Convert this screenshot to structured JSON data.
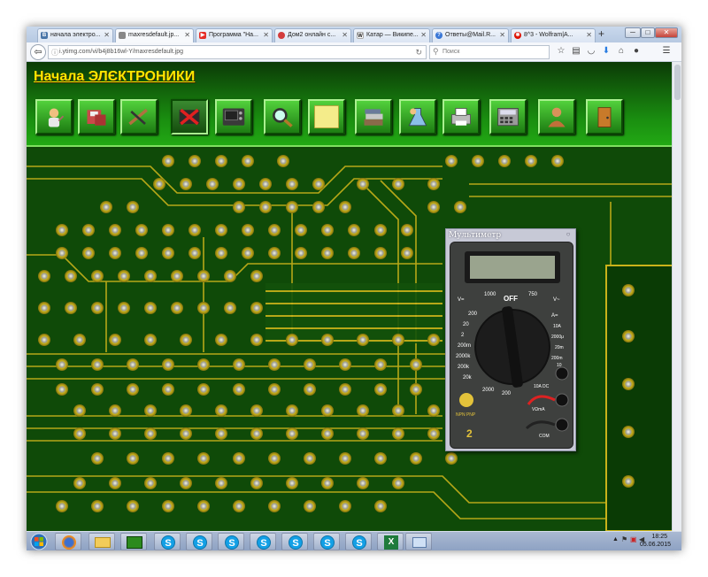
{
  "browser": {
    "tabs": [
      {
        "label": "начала электро...",
        "icon": "vk-icon",
        "color": "#4a76a8"
      },
      {
        "label": "maxresdefault.jp...",
        "icon": "image-icon",
        "color": "#888888",
        "active": true
      },
      {
        "label": "Программа \"На...",
        "icon": "youtube-icon",
        "color": "#e52d27"
      },
      {
        "label": "Дом2 онлайн с...",
        "icon": "dom2-icon",
        "color": "#d33c3c"
      },
      {
        "label": "Катар — Википе...",
        "icon": "wikipedia-icon",
        "color": "#444444"
      },
      {
        "label": "Ответы@Mail.R...",
        "icon": "mailru-answers-icon",
        "color": "#3a77d6"
      },
      {
        "label": "8^3 - Wolfram|A...",
        "icon": "wolfram-icon",
        "color": "#dd1100"
      }
    ],
    "new_tab": "+",
    "url": "i.ytimg.com/vi/b4j8b16wl-Y/maxresdefault.jpg",
    "search_placeholder": "Поиск",
    "window_buttons": [
      "─",
      "□",
      "✕"
    ]
  },
  "page": {
    "title": "Начала ЭЛЄКТРОНИКИ",
    "toolbar": [
      {
        "name": "chemist-icon",
        "color": "#d9a55a"
      },
      {
        "name": "diskette-icon",
        "color": "#c94a4a"
      },
      {
        "name": "wire-tool-icon",
        "color": "#a06a3a"
      },
      {
        "name": "delete-icon",
        "color": "#cc2222",
        "pressed": true
      },
      {
        "name": "oscilloscope-icon",
        "color": "#333333"
      },
      {
        "name": "magnifier-icon",
        "color": "#b07a2a"
      },
      {
        "name": "blank-page-icon",
        "color": "#f4ec8a"
      },
      {
        "name": "books-icon",
        "color": "#8a6a4a"
      },
      {
        "name": "lab-flask-icon",
        "color": "#5a8ac0"
      },
      {
        "name": "printer-icon",
        "color": "#c0c0c0"
      },
      {
        "name": "calculator-icon",
        "color": "#9a9a9a"
      },
      {
        "name": "help-person-icon",
        "color": "#d9925a"
      },
      {
        "name": "exit-door-icon",
        "color": "#c87a2a"
      }
    ],
    "multimeter": {
      "title": "Мультиметр",
      "off_label": "OFF",
      "range_labels": [
        "V=",
        "1000",
        "OFF",
        "750",
        "V~",
        "200",
        "20",
        "2",
        "200m",
        "2000k",
        "200k",
        "20k",
        "2000",
        "200",
        "A=",
        "10A",
        "2000μ",
        "20m",
        "200m",
        "10"
      ],
      "hfe_label": "NPN PNP",
      "jack_labels": [
        "10A DC",
        "VΩmA",
        "COM"
      ],
      "probe_count": "2"
    }
  },
  "taskbar": {
    "apps": [
      "firefox-icon",
      "explorer-icon",
      "electronics-app-icon",
      "skype-icon",
      "skype-icon",
      "skype-icon",
      "skype-icon",
      "skype-icon",
      "skype-icon",
      "skype-icon",
      "excel-icon",
      "window-icon"
    ],
    "time": "18:25",
    "date": "05.06.2015"
  }
}
